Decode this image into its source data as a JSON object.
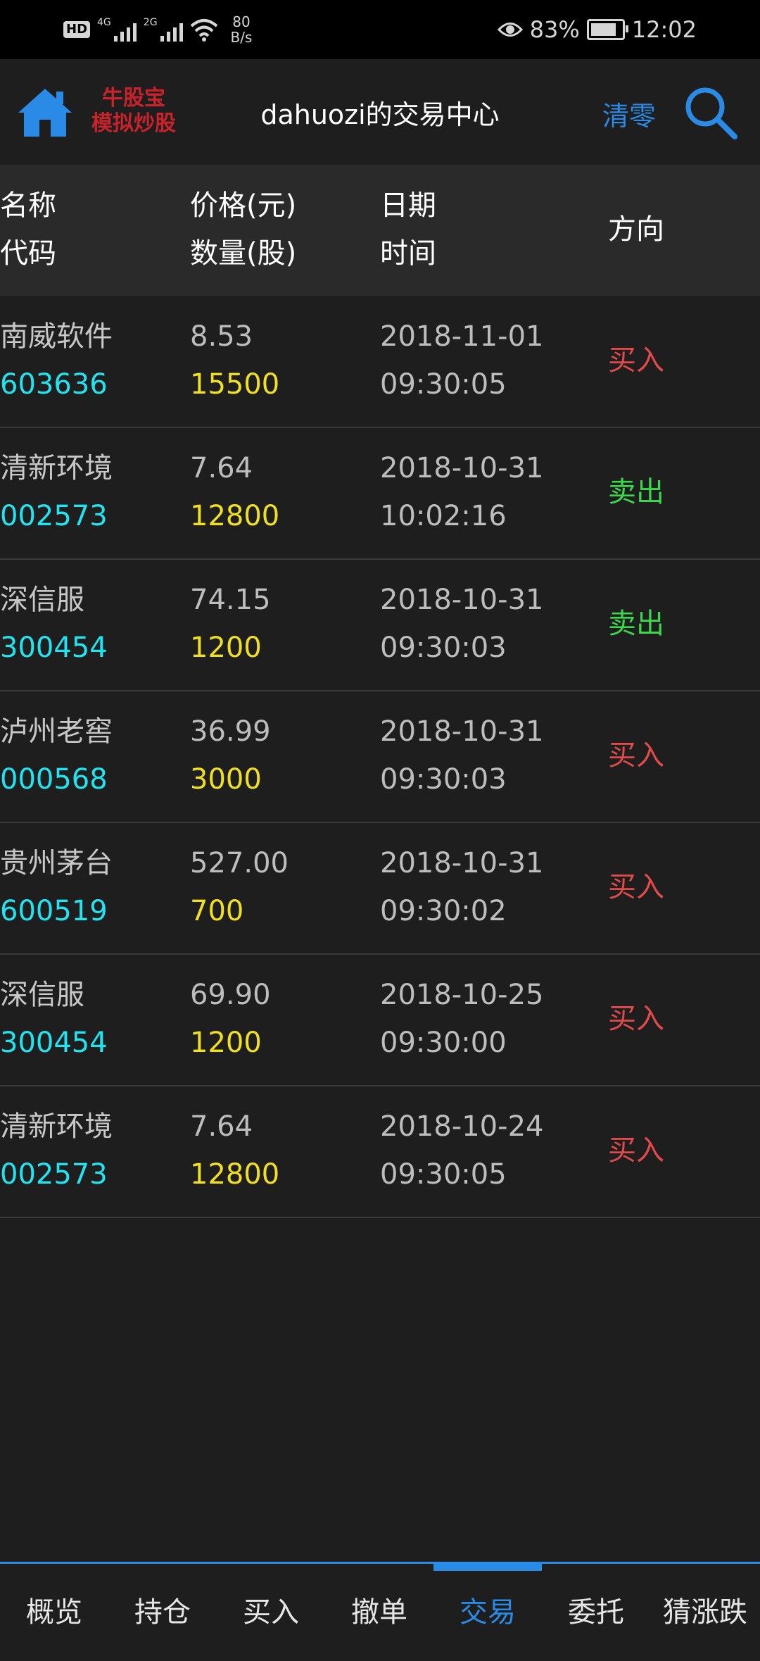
{
  "status_bar": {
    "hd": "HD",
    "sig1": "4G",
    "sig2": "2G",
    "net_speed": "80",
    "net_unit": "B/s",
    "battery": "83%",
    "battery_level": 0.83,
    "time": "12:02"
  },
  "header": {
    "logo_line1": "牛股宝",
    "logo_line2": "模拟炒股",
    "title": "dahuozi的交易中心",
    "reset_label": "清零"
  },
  "table": {
    "headers": {
      "name": "名称",
      "code": "代码",
      "price": "价格(元)",
      "qty": "数量(股)",
      "date": "日期",
      "time": "时间",
      "direction": "方向"
    },
    "rows": [
      {
        "name": "南威软件",
        "code": "603636",
        "price": "8.53",
        "qty": "15500",
        "date": "2018-11-01",
        "time": "09:30:05",
        "direction": "买入",
        "type": "buy"
      },
      {
        "name": "清新环境",
        "code": "002573",
        "price": "7.64",
        "qty": "12800",
        "date": "2018-10-31",
        "time": "10:02:16",
        "direction": "卖出",
        "type": "sell"
      },
      {
        "name": "深信服",
        "code": "300454",
        "price": "74.15",
        "qty": "1200",
        "date": "2018-10-31",
        "time": "09:30:03",
        "direction": "卖出",
        "type": "sell"
      },
      {
        "name": "泸州老窖",
        "code": "000568",
        "price": "36.99",
        "qty": "3000",
        "date": "2018-10-31",
        "time": "09:30:03",
        "direction": "买入",
        "type": "buy"
      },
      {
        "name": "贵州茅台",
        "code": "600519",
        "price": "527.00",
        "qty": "700",
        "date": "2018-10-31",
        "time": "09:30:02",
        "direction": "买入",
        "type": "buy"
      },
      {
        "name": "深信服",
        "code": "300454",
        "price": "69.90",
        "qty": "1200",
        "date": "2018-10-25",
        "time": "09:30:00",
        "direction": "买入",
        "type": "buy"
      },
      {
        "name": "清新环境",
        "code": "002573",
        "price": "7.64",
        "qty": "12800",
        "date": "2018-10-24",
        "time": "09:30:05",
        "direction": "买入",
        "type": "buy"
      }
    ]
  },
  "nav": {
    "tabs": [
      {
        "label": "概览"
      },
      {
        "label": "持仓"
      },
      {
        "label": "买入"
      },
      {
        "label": "撤单"
      },
      {
        "label": "交易",
        "active": true
      },
      {
        "label": "委托"
      },
      {
        "label": "猜涨跌"
      }
    ]
  },
  "colors": {
    "accent": "#2a8be6",
    "buy": "#e04a4a",
    "sell": "#3ad84a",
    "code": "#22e4f0",
    "qty": "#f0e020"
  }
}
